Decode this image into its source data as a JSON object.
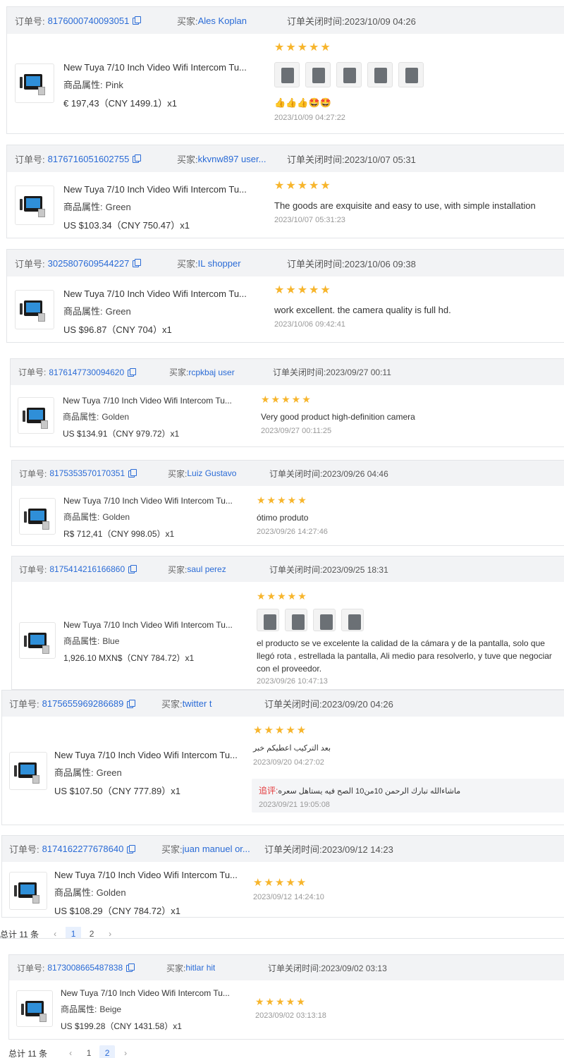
{
  "labels": {
    "order_no": "订单号:",
    "buyer": "买家:",
    "close_time": "订单关闭时间:",
    "attr": "商品属性:",
    "followup": "追评:"
  },
  "orders": [
    {
      "order_no": "8176000740093051",
      "buyer": "Ales Koplan",
      "close_time": "2023/10/09 04:26",
      "title": "New Tuya 7/10 Inch Video Wifi Intercom Tu...",
      "attr": "Pink",
      "price": "€ 197,43（CNY  1499.1）x1",
      "stars": "★★★★★",
      "review": "👍👍👍🤩🤩",
      "date": "2023/10/09 04:27:22",
      "photos": 5
    },
    {
      "order_no": "8176716051602755",
      "buyer": "kkvnw897 user...",
      "close_time": "2023/10/07 05:31",
      "title": "New Tuya 7/10 Inch Video Wifi Intercom Tu...",
      "attr": "Green",
      "price": "US $103.34（CNY  750.47）x1",
      "stars": "★★★★★",
      "review": "The goods are exquisite and easy to use, with simple installation",
      "date": "2023/10/07 05:31:23"
    },
    {
      "order_no": "3025807609544227",
      "buyer": "IL shopper",
      "close_time": "2023/10/06 09:38",
      "title": "New Tuya 7/10 Inch Video Wifi Intercom Tu...",
      "attr": "Green",
      "price": "US $96.87（CNY  704）x1",
      "stars": "★★★★★",
      "review": "work excellent. the camera quality is full hd.",
      "date": "2023/10/06 09:42:41"
    },
    {
      "order_no": "8176147730094620",
      "buyer": "rcpkbaj user",
      "close_time": "2023/09/27 00:11",
      "title": "New Tuya 7/10 Inch Video Wifi Intercom Tu...",
      "attr": "Golden",
      "price": "US $134.91（CNY  979.72）x1",
      "stars": "★★★★★",
      "review": "Very good product high-definition camera",
      "date": "2023/09/27 00:11:25"
    },
    {
      "order_no": "8175353570170351",
      "buyer": "Luiz Gustavo",
      "close_time": "2023/09/26 04:46",
      "title": "New Tuya 7/10 Inch Video Wifi Intercom Tu...",
      "attr": "Golden",
      "price": "R$ 712,41（CNY  998.05）x1",
      "stars": "★★★★★",
      "review": "ótimo produto",
      "date": "2023/09/26 14:27:46"
    },
    {
      "order_no": "8175414216166860",
      "buyer": "saul perez",
      "close_time": "2023/09/25 18:31",
      "title": "New Tuya 7/10 Inch Video Wifi Intercom Tu...",
      "attr": "Blue",
      "price": "1,926.10 MXN$（CNY  784.72）x1",
      "stars": "★★★★★",
      "review": "el producto se ve excelente la calidad de la cámara y de la pantalla, solo que llegó rota , estrellada la pantalla, Ali medio para resolverlo, y tuve que negociar con el proveedor.",
      "date": "2023/09/26 10:47:13",
      "photos": 4
    },
    {
      "order_no": "8175655969286689",
      "buyer": "twitter t",
      "close_time": "2023/09/20 04:26",
      "title": "New Tuya 7/10 Inch Video Wifi Intercom Tu...",
      "attr": "Green",
      "price": "US $107.50（CNY  777.89）x1",
      "stars": "★★★★★",
      "review": "بعد التركيب اعطيكم خبر",
      "date": "2023/09/20 04:27:02",
      "followup_text": "ماشاءالله تبارك الرحمن 10من10 الصح فيه يستاهل سعره",
      "followup_date": "2023/09/21 19:05:08"
    },
    {
      "order_no": "8174162277678640",
      "buyer": "juan manuel or...",
      "close_time": "2023/09/12 14:23",
      "title": "New Tuya 7/10 Inch Video Wifi Intercom Tu...",
      "attr": "Golden",
      "price": "US $108.29（CNY  784.72）x1",
      "stars": "★★★★★",
      "review": "",
      "date": "2023/09/12 14:24:10"
    },
    {
      "order_no": "8173008665487838",
      "buyer": "hitlar hit",
      "close_time": "2023/09/02 03:13",
      "title": "New Tuya 7/10 Inch Video Wifi Intercom Tu...",
      "attr": "Beige",
      "price": "US $199.28（CNY  1431.58）x1",
      "stars": "★★★★★",
      "review": "",
      "date": "2023/09/02 03:13:18"
    }
  ],
  "pagination": {
    "total": "总计 11 条",
    "prev": "‹",
    "next": "›",
    "pages": [
      "1",
      "2"
    ]
  }
}
